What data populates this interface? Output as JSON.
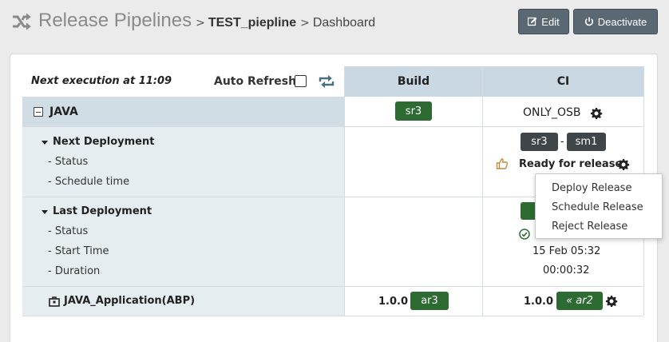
{
  "header": {
    "title": "Release Pipelines",
    "separator": ">",
    "pipeline": "TEST_piepline",
    "page": "Dashboard",
    "edit_label": "Edit",
    "deactivate_label": "Deactivate",
    "logo_icon": "shuffle-icon"
  },
  "toolbar": {
    "next_execution": "Next execution at 11:09",
    "auto_refresh_label": "Auto Refresh",
    "auto_refresh_checked": false
  },
  "columns": [
    "Build",
    "CI"
  ],
  "group": {
    "name": "JAVA",
    "build_badge": "sr3",
    "ci_env": "ONLY_OSB"
  },
  "next_deployment": {
    "title": "Next Deployment",
    "fields": [
      "- Status",
      "- Schedule time"
    ],
    "ci_badges": [
      "sr3",
      "sm1"
    ],
    "badge_separator": "-",
    "status": "Ready for release"
  },
  "last_deployment": {
    "title": "Last Deployment",
    "fields": [
      "- Status",
      "- Start Time",
      "- Duration"
    ],
    "start_time": "15 Feb 05:32",
    "duration": "00:00:32"
  },
  "application": {
    "name": "JAVA_Application(ABP)",
    "build_version": "1.0.0 -",
    "build_badge": "ar3",
    "ci_version": "1.0.0 -",
    "ci_badge": "« ar2"
  },
  "context_menu": {
    "items": [
      "Deploy Release",
      "Schedule Release",
      "Reject Release"
    ]
  },
  "colors": {
    "badge_green": "#2e6b33",
    "badge_dark": "#3f4549",
    "header_blue": "#c9d8e2",
    "button_gray": "#596873"
  }
}
